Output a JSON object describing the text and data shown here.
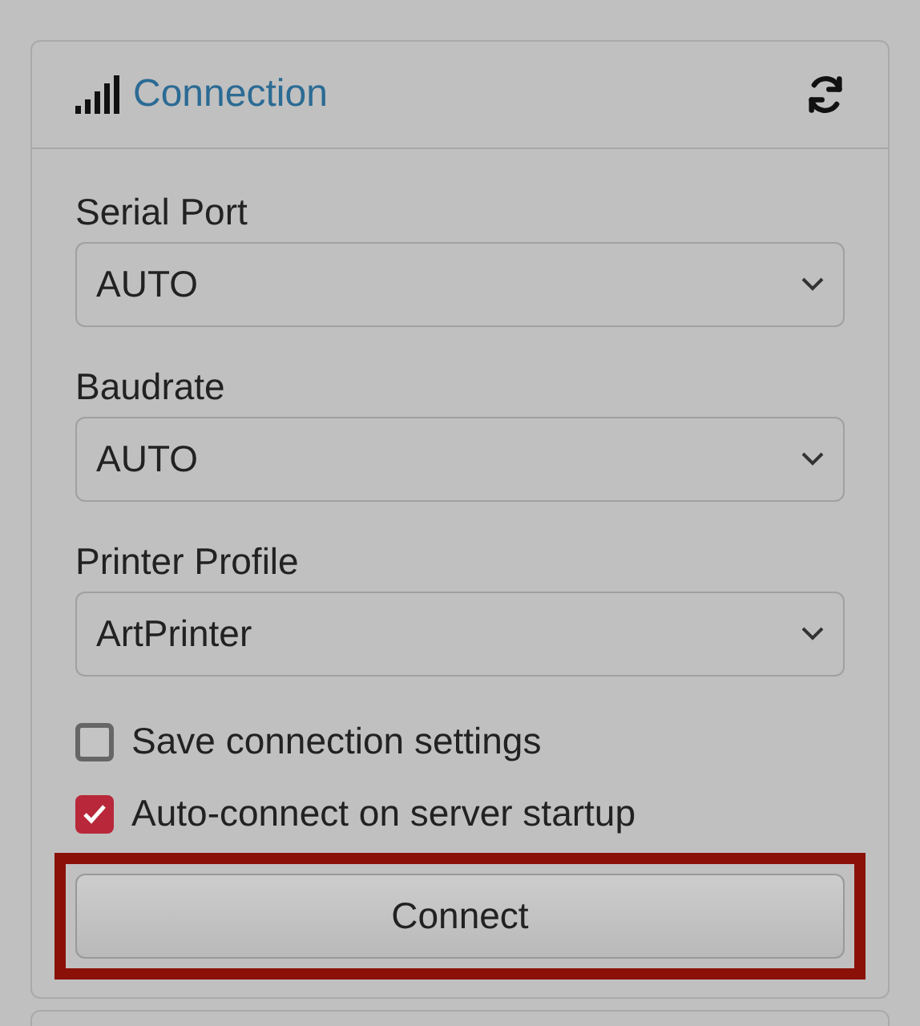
{
  "panel": {
    "title": "Connection"
  },
  "fields": [
    {
      "label": "Serial Port",
      "value": "AUTO"
    },
    {
      "label": "Baudrate",
      "value": "AUTO"
    },
    {
      "label": "Printer Profile",
      "value": "ArtPrinter"
    }
  ],
  "options": [
    {
      "label": "Save connection settings",
      "checked": false
    },
    {
      "label": "Auto-connect on server startup",
      "checked": true
    }
  ],
  "button": {
    "label": "Connect",
    "highlighted": true
  }
}
